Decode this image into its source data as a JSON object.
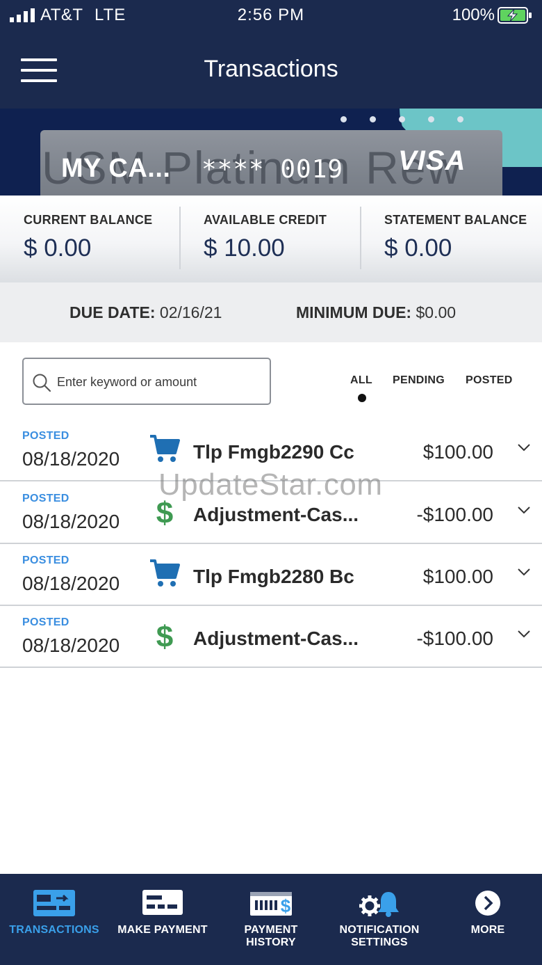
{
  "status_bar": {
    "carrier": "AT&T",
    "network": "LTE",
    "time": "2:56 PM",
    "battery": "100%"
  },
  "header": {
    "title": "Transactions",
    "menu_icon": "hamburger-menu-icon"
  },
  "card": {
    "background_text": "USM Platinum Rew",
    "name": "MY CA...",
    "number": "**** 0019",
    "brand": "VISA",
    "pager_count": 5,
    "pager_active": 2
  },
  "balances": {
    "current": {
      "label": "CURRENT BALANCE",
      "value": "$ 0.00"
    },
    "available": {
      "label": "AVAILABLE CREDIT",
      "value": "$ 10.00"
    },
    "statement": {
      "label": "STATEMENT BALANCE",
      "value": "$ 0.00"
    }
  },
  "due": {
    "date_label": "DUE DATE:",
    "date_value": "02/16/21",
    "min_label": "MINIMUM DUE:",
    "min_value": "$0.00"
  },
  "search": {
    "placeholder": "Enter keyword or amount",
    "value": ""
  },
  "filters": {
    "all": "ALL",
    "pending": "PENDING",
    "posted": "POSTED",
    "selected": "all"
  },
  "transactions": [
    {
      "status": "POSTED",
      "date": "08/18/2020",
      "icon": "shopping-cart-icon",
      "description": "Tlp Fmgb2290 Cc",
      "amount": "$100.00"
    },
    {
      "status": "POSTED",
      "date": "08/18/2020",
      "icon": "dollar-sign-icon",
      "description": "Adjustment-Cas...",
      "amount": "-$100.00"
    },
    {
      "status": "POSTED",
      "date": "08/18/2020",
      "icon": "shopping-cart-icon",
      "description": "Tlp Fmgb2280 Bc",
      "amount": "$100.00"
    },
    {
      "status": "POSTED",
      "date": "08/18/2020",
      "icon": "dollar-sign-icon",
      "description": "Adjustment-Cas...",
      "amount": "-$100.00"
    }
  ],
  "watermark": "UpdateStar.com",
  "bottom_nav": {
    "transactions": "TRANSACTIONS",
    "make_payment": "MAKE PAYMENT",
    "payment_history_1": "PAYMENT",
    "payment_history_2": "HISTORY",
    "notification_1": "NOTIFICATION",
    "notification_2": "SETTINGS",
    "more": "MORE",
    "active": "transactions"
  },
  "colors": {
    "navy": "#1b2a4e",
    "card_navy": "#0f2150",
    "teal": "#6cc5c7",
    "posted_blue": "#3a8ee0",
    "cart_blue": "#1f6fb3",
    "dollar_green": "#3f9a52",
    "active_nav": "#3aa0ea"
  }
}
